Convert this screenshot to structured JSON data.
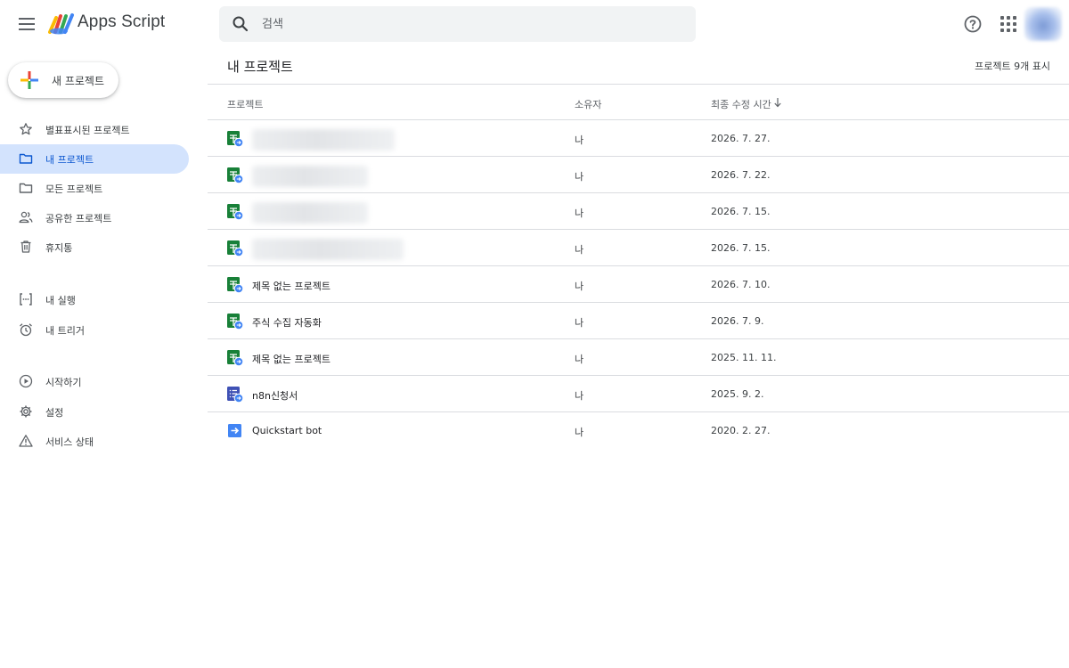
{
  "app": {
    "title": "Apps Script"
  },
  "search": {
    "placeholder": "검색"
  },
  "sidebar": {
    "new_project": "새 프로젝트",
    "items": [
      {
        "label": "별표표시된 프로젝트",
        "icon": "star-icon"
      },
      {
        "label": "내 프로젝트",
        "icon": "folder-icon",
        "active": true
      },
      {
        "label": "모든 프로젝트",
        "icon": "folder-icon"
      },
      {
        "label": "공유한 프로젝트",
        "icon": "people-icon"
      },
      {
        "label": "휴지통",
        "icon": "trash-icon"
      },
      {
        "label": "내 실행",
        "icon": "executions-icon"
      },
      {
        "label": "내 트리거",
        "icon": "alarm-icon"
      },
      {
        "label": "시작하기",
        "icon": "play-circle-icon"
      },
      {
        "label": "설정",
        "icon": "gear-icon"
      },
      {
        "label": "서비스 상태",
        "icon": "warning-icon"
      }
    ]
  },
  "main": {
    "title": "내 프로젝트",
    "count": "프로젝트 9개 표시",
    "columns": {
      "name": "프로젝트",
      "owner": "소유자",
      "modified": "최종 수정 시간"
    },
    "rows": [
      {
        "name": "",
        "owner": "나",
        "date": "2026. 7. 27.",
        "icon": "sheets-script-icon",
        "redacted": true
      },
      {
        "name": "",
        "owner": "나",
        "date": "2026. 7. 22.",
        "icon": "sheets-script-icon",
        "redacted": true
      },
      {
        "name": "",
        "owner": "나",
        "date": "2026. 7. 15.",
        "icon": "sheets-script-icon",
        "redacted": true
      },
      {
        "name": "",
        "owner": "나",
        "date": "2026. 7. 15.",
        "icon": "sheets-script-icon",
        "redacted": true
      },
      {
        "name": "제목 없는 프로젝트",
        "owner": "나",
        "date": "2026. 7. 10.",
        "icon": "sheets-script-icon"
      },
      {
        "name": "주식 수집 자동화",
        "owner": "나",
        "date": "2026. 7. 9.",
        "icon": "sheets-script-icon"
      },
      {
        "name": "제목 없는 프로젝트",
        "owner": "나",
        "date": "2025. 11. 11.",
        "icon": "sheets-script-icon"
      },
      {
        "name": "n8n신청서",
        "owner": "나",
        "date": "2025. 9. 2.",
        "icon": "forms-script-icon"
      },
      {
        "name": "Quickstart bot",
        "owner": "나",
        "date": "2020. 2. 27.",
        "icon": "standalone-script-icon"
      }
    ]
  },
  "colors": {
    "accent": "#0b57d0",
    "active_bg": "#d3e3fd",
    "sheets_green": "#188038",
    "script_blue": "#4285f4"
  }
}
